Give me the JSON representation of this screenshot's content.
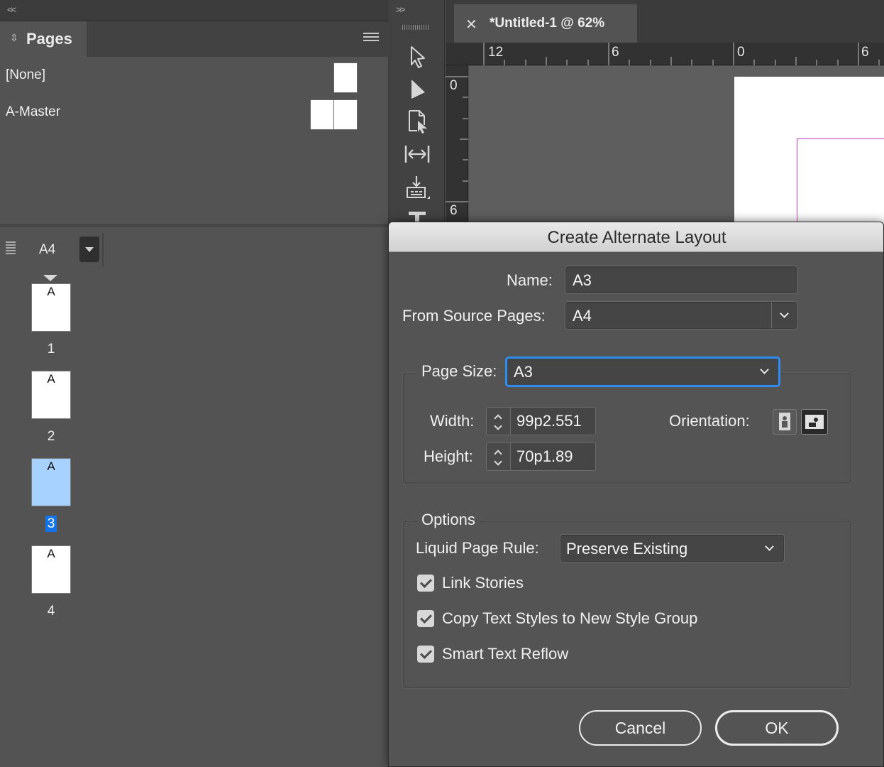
{
  "panel": {
    "collapse_left": "<<",
    "collapse_right": ">>",
    "tab_title": "Pages",
    "masters": [
      {
        "label": "[None]"
      },
      {
        "label": "A-Master"
      }
    ],
    "layout_size": "A4",
    "pages": [
      {
        "number": "1",
        "master": "A",
        "selected": false
      },
      {
        "number": "2",
        "master": "A",
        "selected": false
      },
      {
        "number": "3",
        "master": "A",
        "selected": true
      },
      {
        "number": "4",
        "master": "A",
        "selected": false
      }
    ]
  },
  "tools": [
    "selection-tool",
    "direct-selection-tool",
    "page-tool",
    "gap-tool",
    "content-collector-tool",
    "type-tool"
  ],
  "document": {
    "tab_title": "*Untitled-1 @ 62%",
    "ruler_h": [
      "12",
      "6",
      "0",
      "6"
    ],
    "ruler_v": [
      "0",
      "6"
    ]
  },
  "dialog": {
    "title": "Create Alternate Layout",
    "name_label": "Name:",
    "name_value": "A3",
    "source_label": "From Source Pages:",
    "source_value": "A4",
    "page_size_label": "Page Size:",
    "page_size_value": "A3",
    "width_label": "Width:",
    "width_value": "99p2.551",
    "height_label": "Height:",
    "height_value": "70p1.89",
    "orientation_label": "Orientation:",
    "orientation_selected": "landscape",
    "options_title": "Options",
    "liquid_label": "Liquid Page Rule:",
    "liquid_value": "Preserve Existing",
    "checkboxes": [
      {
        "label": "Link Stories",
        "checked": true
      },
      {
        "label": "Copy Text Styles to New Style Group",
        "checked": true
      },
      {
        "label": "Smart Text Reflow",
        "checked": true
      }
    ],
    "cancel_label": "Cancel",
    "ok_label": "OK"
  },
  "colors": {
    "selection_blue": "#1473e6",
    "selected_page_fill": "#a7d2ff",
    "margin_guide": "#c33cc8",
    "focus_ring": "#2d8cf0"
  }
}
